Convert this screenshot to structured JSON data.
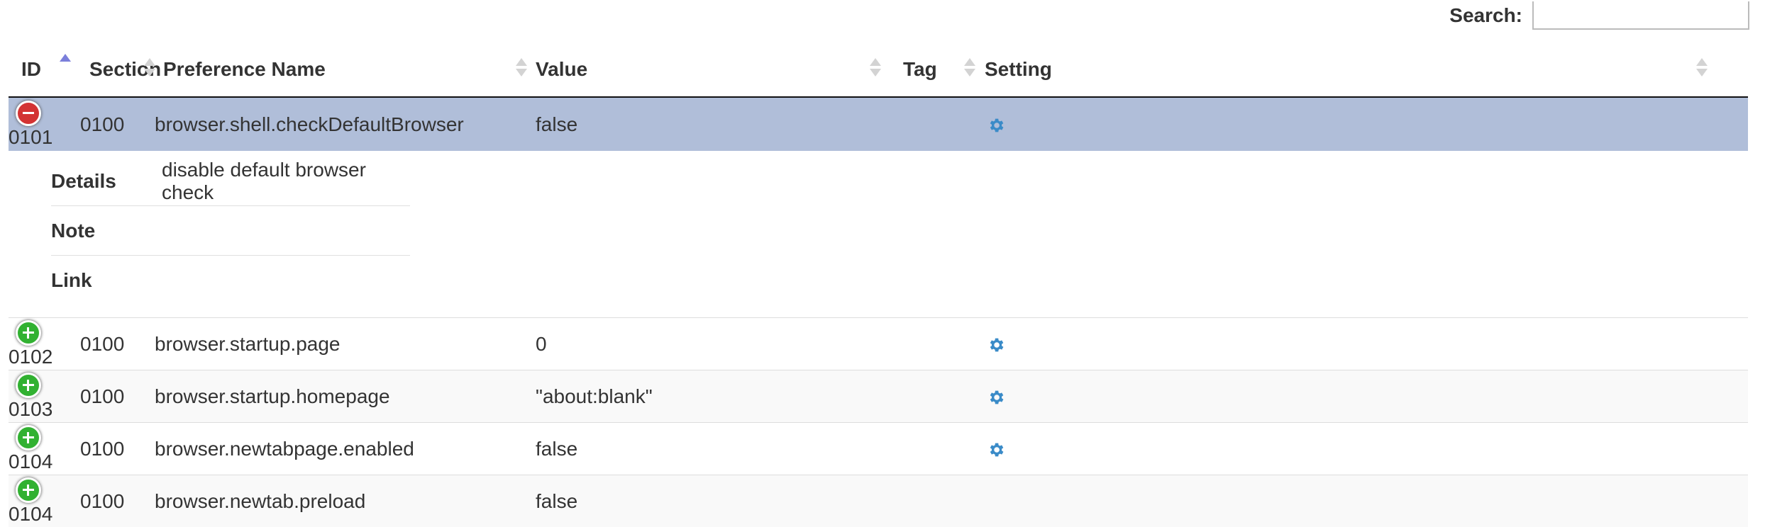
{
  "search": {
    "label": "Search:",
    "value": ""
  },
  "table": {
    "columns": [
      {
        "label": "ID",
        "sort": "asc"
      },
      {
        "label": "Section",
        "sort": "none"
      },
      {
        "label": "Preference Name",
        "sort": "none"
      },
      {
        "label": "Value",
        "sort": "none"
      },
      {
        "label": "Tag",
        "sort": "none"
      },
      {
        "label": "Setting",
        "sort": "none"
      }
    ],
    "rows": [
      {
        "id": "0101",
        "section": "0100",
        "pref": "browser.shell.checkDefaultBrowser",
        "value": "false",
        "tag": "",
        "has_setting": true,
        "expanded": true
      },
      {
        "id": "0102",
        "section": "0100",
        "pref": "browser.startup.page",
        "value": "0",
        "tag": "",
        "has_setting": true,
        "expanded": false
      },
      {
        "id": "0103",
        "section": "0100",
        "pref": "browser.startup.homepage",
        "value": "\"about:blank\"",
        "tag": "",
        "has_setting": true,
        "expanded": false
      },
      {
        "id": "0104",
        "section": "0100",
        "pref": "browser.newtabpage.enabled",
        "value": "false",
        "tag": "",
        "has_setting": true,
        "expanded": false
      },
      {
        "id": "0104",
        "section": "0100",
        "pref": "browser.newtab.preload",
        "value": "false",
        "tag": "",
        "has_setting": false,
        "expanded": false
      }
    ],
    "details": [
      {
        "label": "Details",
        "value": "disable default browser check"
      },
      {
        "label": "Note",
        "value": ""
      },
      {
        "label": "Link",
        "value": ""
      }
    ]
  },
  "icons": {
    "collapse": "minus-circle-icon",
    "expand": "plus-circle-icon",
    "setting": "gear-icon"
  },
  "colors": {
    "selected_row": "#b0bed9",
    "collapse": "#d33333",
    "expand": "#31b131",
    "gear": "#3a8bc8",
    "sort_active": "#7b7fdb"
  }
}
